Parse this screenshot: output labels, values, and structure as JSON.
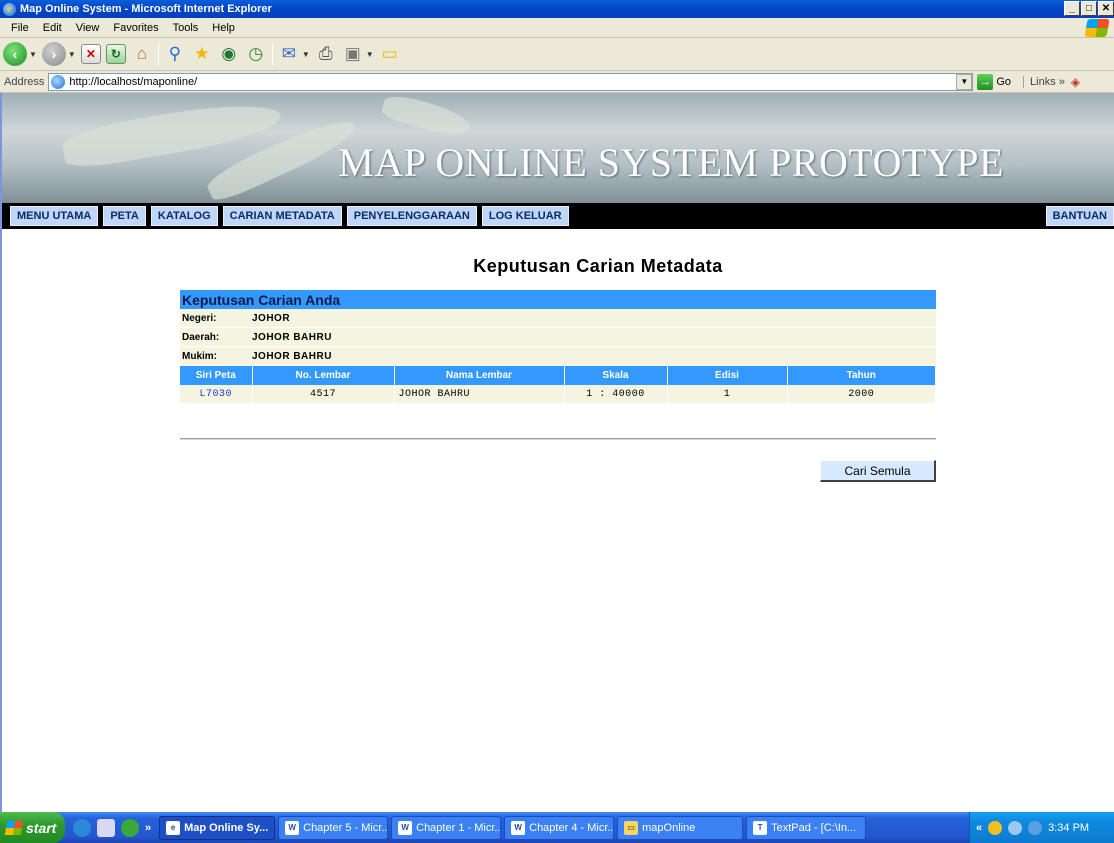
{
  "window": {
    "title": "Map Online System - Microsoft Internet Explorer",
    "ie_glyph": "e",
    "controls": {
      "minimize": "_",
      "maximize": "□",
      "close": "✕"
    }
  },
  "menu": [
    "File",
    "Edit",
    "View",
    "Favorites",
    "Tools",
    "Help"
  ],
  "toolbar": {
    "back_glyph": "‹",
    "forward_glyph": "›",
    "dropdown_glyph": "▼",
    "stop_glyph": "✕",
    "refresh_glyph": "↻",
    "home_glyph": "⌂",
    "search_glyph": "⚲",
    "favorites_glyph": "★",
    "media_glyph": "◉",
    "history_glyph": "◷",
    "mail_glyph": "✉",
    "print_glyph": "⎙",
    "edit_glyph": "▣",
    "messenger_glyph": "▭"
  },
  "address": {
    "label": "Address",
    "url": "http://localhost/maponline/",
    "dropdown_glyph": "▼",
    "go_glyph": "→",
    "go_label": "Go",
    "links_label": "Links",
    "links_chevron": "»",
    "extra_glyph": "◈"
  },
  "banner": {
    "title": "MAP ONLINE SYSTEM PROTOTYPE"
  },
  "nav": {
    "items": [
      "MENU UTAMA",
      "PETA",
      "KATALOG",
      "CARIAN METADATA",
      "PENYELENGGARAAN",
      "LOG KELUAR"
    ],
    "help": "BANTUAN"
  },
  "page": {
    "heading": "Keputusan Carian Metadata",
    "results_header": "Keputusan Carian Anda",
    "info": [
      {
        "label": "Negeri:",
        "value": "JOHOR"
      },
      {
        "label": "Daerah:",
        "value": "JOHOR BAHRU"
      },
      {
        "label": "Mukim:",
        "value": "JOHOR BAHRU"
      }
    ],
    "table": {
      "columns": [
        "Siri Peta",
        "No. Lembar",
        "Nama Lembar",
        "Skala",
        "Edisi",
        "Tahun"
      ],
      "rows": [
        {
          "siri": "L7030",
          "no_lembar": "4517",
          "nama": "JOHOR BAHRU",
          "skala": "1 : 40000",
          "edisi": "1",
          "tahun": "2000"
        }
      ]
    },
    "search_again": "Cari Semula"
  },
  "taskbar": {
    "start": "start",
    "quicklaunch_chevron": "»",
    "tasks": [
      {
        "label": "Map Online Sy...",
        "active": true,
        "icon": "e"
      },
      {
        "label": "Chapter 5 - Micr...",
        "active": false,
        "icon": "W"
      },
      {
        "label": "Chapter 1 - Micr...",
        "active": false,
        "icon": "W"
      },
      {
        "label": "Chapter 4 - Micr...",
        "active": false,
        "icon": "W"
      },
      {
        "label": "mapOnline",
        "active": false,
        "icon": "▭"
      },
      {
        "label": "TextPad - [C:\\In...",
        "active": false,
        "icon": "T"
      }
    ],
    "tray_chevron": "«",
    "time": "3:34 PM"
  },
  "colors": {
    "results_header": "#3399ff",
    "nav_button": "#bfd6f6",
    "row_bg": "#f4f4e0",
    "link": "#1a3fd0"
  }
}
